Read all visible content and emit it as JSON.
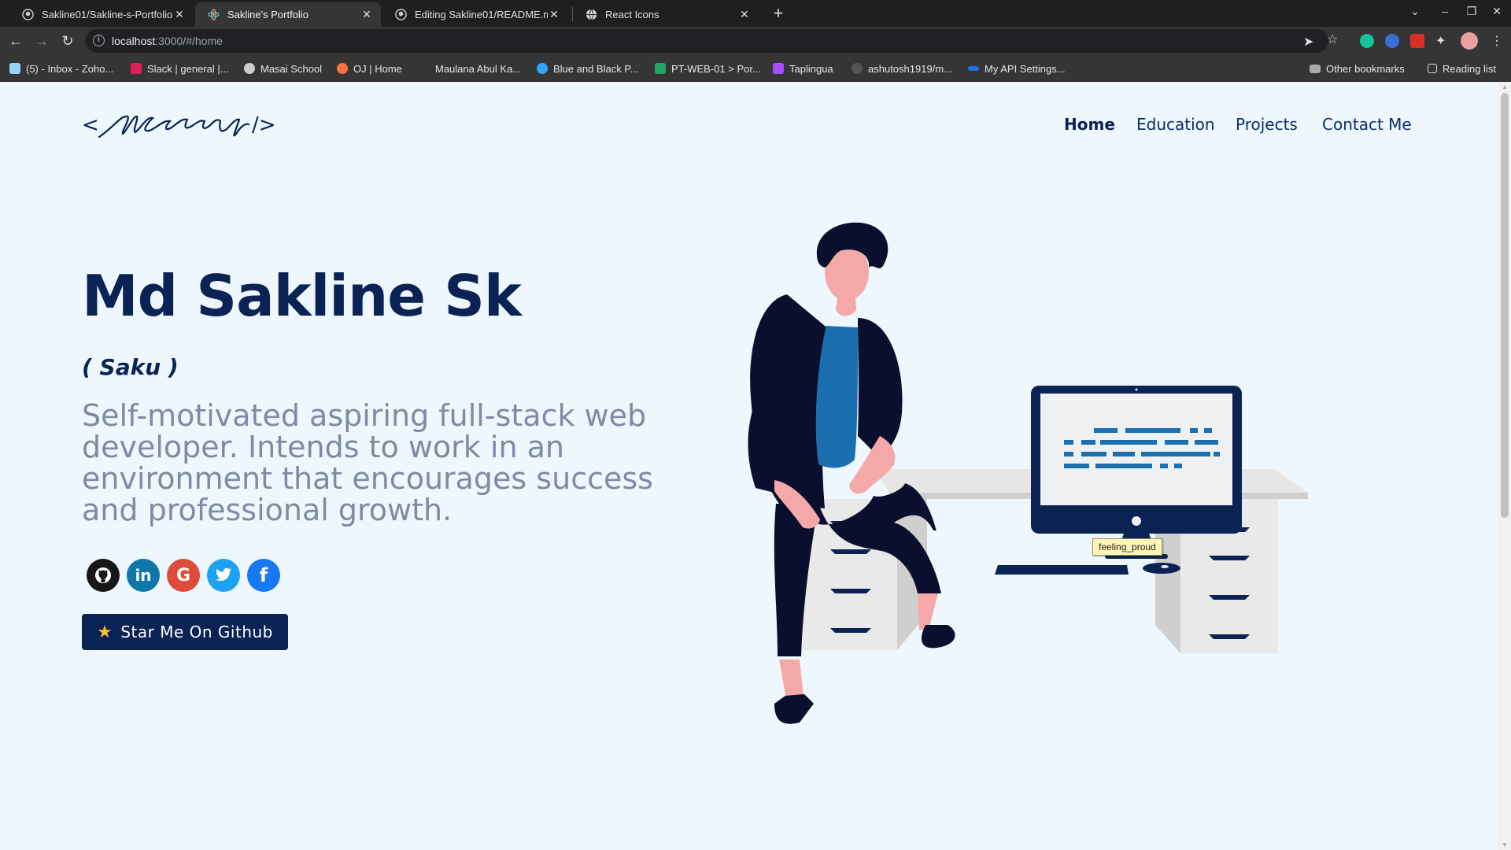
{
  "browser": {
    "tabs": [
      {
        "title": "Sakline01/Sakline-s-Portfolio",
        "icon": "github-icon",
        "active": false
      },
      {
        "title": "Sakline's Portfolio",
        "icon": "react-icon",
        "active": true
      },
      {
        "title": "Editing Sakline01/README.m",
        "icon": "github-icon",
        "active": false
      },
      {
        "title": "React Icons",
        "icon": "globe-icon",
        "active": false
      }
    ],
    "url_host": "localhost",
    "url_path": ":3000/#/home",
    "bookmarks": [
      {
        "label": "(5) - Inbox - Zoho...",
        "icon": "zoho-icon",
        "color": "#9ad3f5"
      },
      {
        "label": "Slack | general |...",
        "icon": "slack-icon",
        "color": "#e01e5a"
      },
      {
        "label": "Masai School",
        "icon": "globe-icon",
        "color": "#cccccc"
      },
      {
        "label": "OJ | Home",
        "icon": "oj-icon",
        "color": "#ff7043"
      },
      {
        "label": "Maulana Abul Ka...",
        "icon": "page-icon",
        "color": "#353535"
      },
      {
        "label": "Blue and Black P...",
        "icon": "canva-icon",
        "color": "#2fa6ff"
      },
      {
        "label": "PT-WEB-01 > Por...",
        "icon": "sheets-icon",
        "color": "#23a566"
      },
      {
        "label": "Taplingua",
        "icon": "taplingua-icon",
        "color": "#a64dff"
      },
      {
        "label": "ashutosh1919/m...",
        "icon": "github-icon",
        "color": "#555555"
      },
      {
        "label": "My API Settings...",
        "icon": "api-icon",
        "color": "#1a73e8"
      }
    ],
    "other_bookmarks": "Other bookmarks",
    "reading_list": "Reading list"
  },
  "nav": {
    "items": [
      "Home",
      "Education",
      "Projects",
      "Contact Me"
    ],
    "active": "Home"
  },
  "hero": {
    "name": "Md Sakline Sk",
    "nickname": "( Saku )",
    "description": "Self-motivated aspiring full-stack web developer. Intends to work in an environment that encourages success and professional growth.",
    "cta_label": "Star Me On Github",
    "socials": [
      {
        "name": "github",
        "glyph": "",
        "color": "#181717"
      },
      {
        "name": "linkedin",
        "glyph": "in",
        "color": "#0e76a8"
      },
      {
        "name": "google",
        "glyph": "G",
        "color": "#dd4b39"
      },
      {
        "name": "twitter",
        "glyph": "",
        "color": "#1da1f2"
      },
      {
        "name": "facebook",
        "glyph": "f",
        "color": "#1877f2"
      }
    ]
  },
  "tooltip": "feeling_proud",
  "colors": {
    "primary": "#0a2254",
    "muted_text": "#7e8aa6",
    "background": "#edf7fd"
  }
}
